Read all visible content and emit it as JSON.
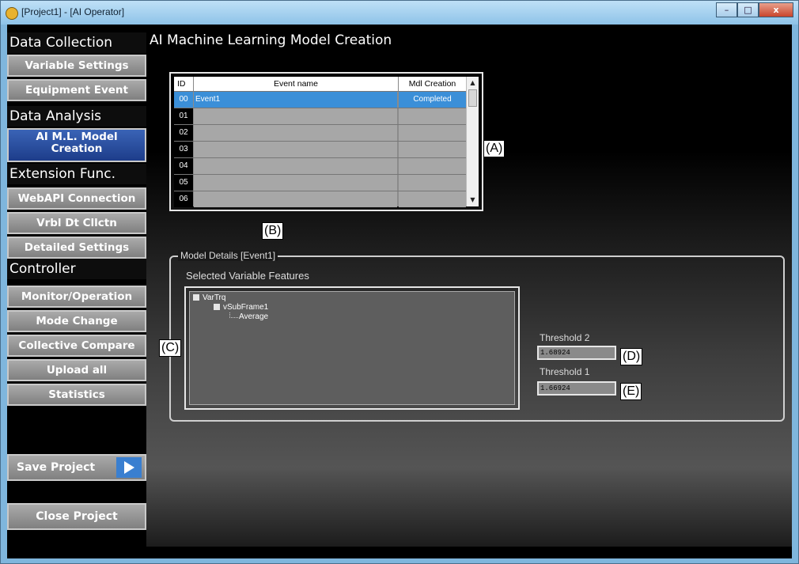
{
  "window": {
    "title": "[Project1] - [AI Operator]",
    "min_glyph": "–",
    "max_glyph": "□",
    "close_glyph": "x"
  },
  "sidebar": {
    "sections": {
      "data_collection": "Data Collection",
      "data_analysis": "Data Analysis",
      "extension": "Extension Func.",
      "controller": "Controller"
    },
    "items": {
      "variable_settings": "Variable Settings",
      "equipment_event": "Equipment Event",
      "ai_ml_line1": "AI M.L. Model",
      "ai_ml_line2": "Creation",
      "webapi": "WebAPI Connection",
      "vrbl": "Vrbl Dt Cllctn",
      "detailed": "Detailed Settings",
      "monitor": "Monitor/Operation",
      "mode": "Mode Change",
      "collective": "Collective Compare",
      "upload": "Upload all",
      "statistics": "Statistics"
    },
    "save_project": "Save Project",
    "close_project": "Close Project"
  },
  "main": {
    "title": "AI Machine Learning Model Creation",
    "table": {
      "headers": {
        "id": "ID",
        "name": "Event name",
        "status": "Mdl Creation"
      },
      "rows": [
        {
          "id": "00",
          "name": "Event1",
          "status": "Completed",
          "selected": true
        },
        {
          "id": "01",
          "name": "",
          "status": ""
        },
        {
          "id": "02",
          "name": "",
          "status": ""
        },
        {
          "id": "03",
          "name": "",
          "status": ""
        },
        {
          "id": "04",
          "name": "",
          "status": ""
        },
        {
          "id": "05",
          "name": "",
          "status": ""
        },
        {
          "id": "06",
          "name": "",
          "status": ""
        }
      ]
    },
    "details_title": "Model Details [Event1]",
    "selected_features_label": "Selected Variable Features",
    "tree": {
      "root": "VarTrq",
      "child": "vSubFrame1",
      "leaf": "Average"
    },
    "threshold2_label": "Threshold 2",
    "threshold2_value": "1.68924",
    "threshold1_label": "Threshold 1",
    "threshold1_value": "1.66924"
  },
  "callouts": {
    "a": "(A)",
    "b": "(B)",
    "c": "(C)",
    "d": "(D)",
    "e": "(E)"
  },
  "icons": {
    "app": "app-icon",
    "tree_toggle": "collapse-box-icon",
    "save_arrow": "play-arrow-icon"
  }
}
